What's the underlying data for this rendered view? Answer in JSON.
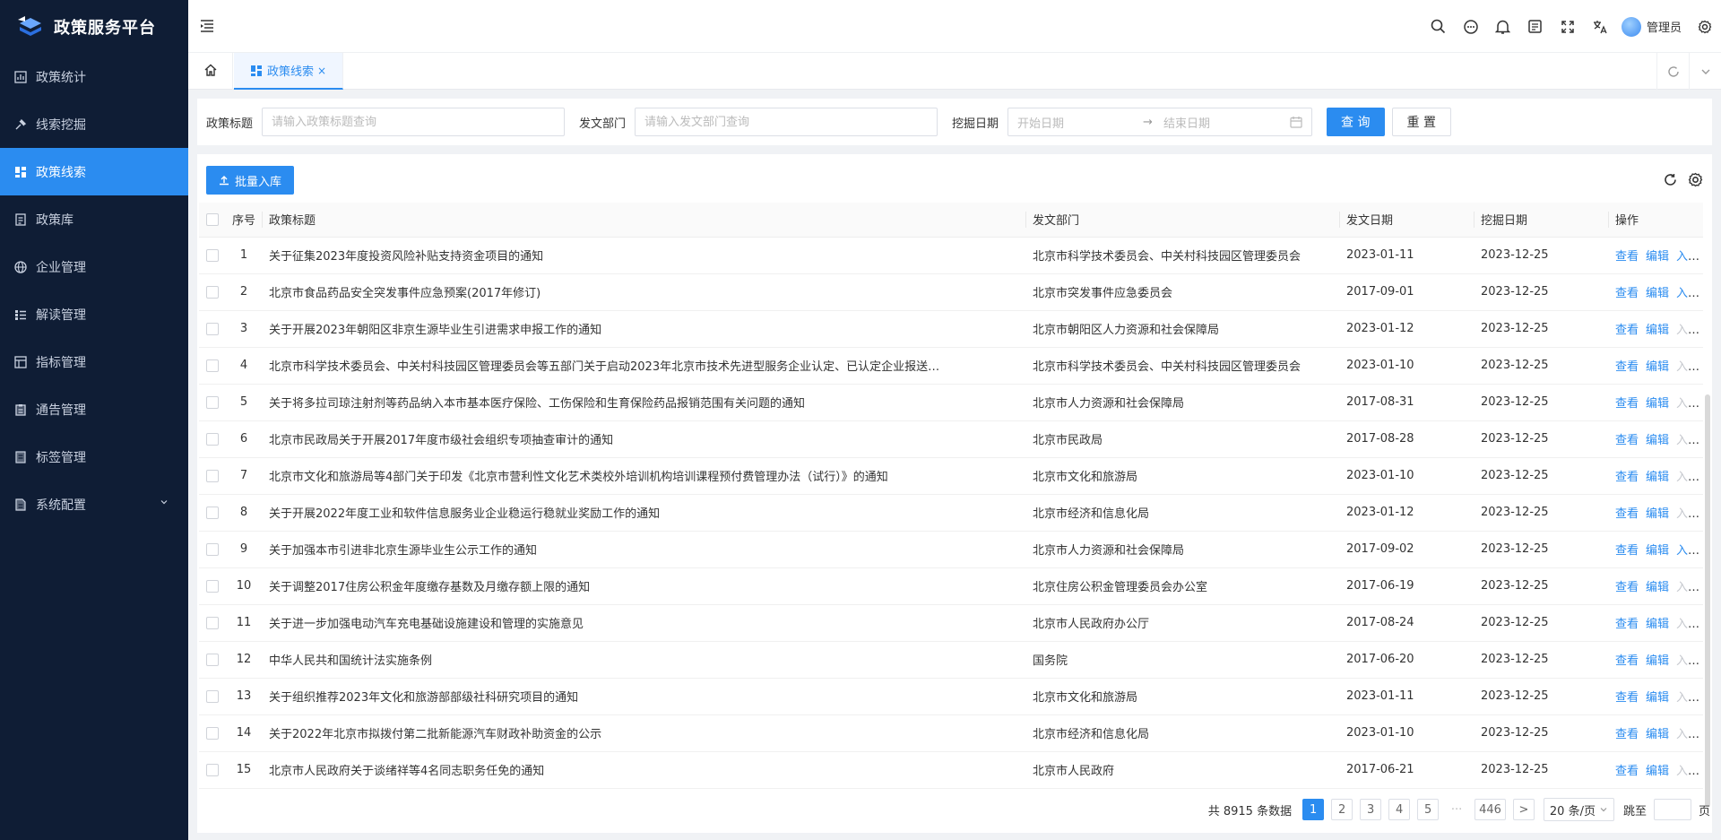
{
  "app": {
    "title": "政策服务平台"
  },
  "sidebar": {
    "items": [
      {
        "label": "政策统计",
        "icon": "chart-icon"
      },
      {
        "label": "线索挖掘",
        "icon": "pick-icon"
      },
      {
        "label": "政策线索",
        "icon": "dashboard-icon",
        "active": true
      },
      {
        "label": "政策库",
        "icon": "doc-icon"
      },
      {
        "label": "企业管理",
        "icon": "globe-icon"
      },
      {
        "label": "解读管理",
        "icon": "list-icon"
      },
      {
        "label": "指标管理",
        "icon": "form-icon"
      },
      {
        "label": "通告管理",
        "icon": "clipboard-icon"
      },
      {
        "label": "标签管理",
        "icon": "tag-icon"
      },
      {
        "label": "系统配置",
        "icon": "settings-doc-icon",
        "has_children": true
      }
    ]
  },
  "header": {
    "user_name": "管理员"
  },
  "tabs": {
    "active_label": "政策线索",
    "close_glyph": "×"
  },
  "search": {
    "title_label": "政策标题",
    "title_placeholder": "请输入政策标题查询",
    "dept_label": "发文部门",
    "dept_placeholder": "请输入发文部门查询",
    "date_label": "挖掘日期",
    "start_placeholder": "开始日期",
    "end_placeholder": "结束日期",
    "arrow": "→",
    "query_button": "查 询",
    "reset_button": "重 置"
  },
  "toolbar": {
    "batch_button": "批量入库"
  },
  "table": {
    "headers": {
      "index": "序号",
      "title": "政策标题",
      "dept": "发文部门",
      "issue_date": "发文日期",
      "mine_date": "挖掘日期",
      "ops": "操作"
    },
    "ops": {
      "view": "查看",
      "edit": "编辑",
      "store": "入库"
    },
    "rows": [
      {
        "index": "1",
        "title": "关于征集2023年度投资风险补贴支持资金项目的通知",
        "dept": "北京市科学技术委员会、中关村科技园区管理委员会",
        "issue_date": "2023-01-11",
        "mine_date": "2023-12-25",
        "store_enabled": true
      },
      {
        "index": "2",
        "title": "北京市食品药品安全突发事件应急预案(2017年修订)",
        "dept": "北京市突发事件应急委员会",
        "issue_date": "2017-09-01",
        "mine_date": "2023-12-25",
        "store_enabled": true
      },
      {
        "index": "3",
        "title": "关于开展2023年朝阳区非京生源毕业生引进需求申报工作的通知",
        "dept": "北京市朝阳区人力资源和社会保障局",
        "issue_date": "2023-01-12",
        "mine_date": "2023-12-25",
        "store_enabled": false
      },
      {
        "index": "4",
        "title": "北京市科学技术委员会、中关村科技园区管理委员会等五部门关于启动2023年北京市技术先进型服务企业认定、已认定企业报送…",
        "dept": "北京市科学技术委员会、中关村科技园区管理委员会",
        "issue_date": "2023-01-10",
        "mine_date": "2023-12-25",
        "store_enabled": false
      },
      {
        "index": "5",
        "title": "关于将多拉司琼注射剂等药品纳入本市基本医疗保险、工伤保险和生育保险药品报销范围有关问题的通知",
        "dept": "北京市人力资源和社会保障局",
        "issue_date": "2017-08-31",
        "mine_date": "2023-12-25",
        "store_enabled": false
      },
      {
        "index": "6",
        "title": "北京市民政局关于开展2017年度市级社会组织专项抽查审计的通知",
        "dept": "北京市民政局",
        "issue_date": "2017-08-28",
        "mine_date": "2023-12-25",
        "store_enabled": false
      },
      {
        "index": "7",
        "title": "北京市文化和旅游局等4部门关于印发《北京市营利性文化艺术类校外培训机构培训课程预付费管理办法（试行）》的通知",
        "dept": "北京市文化和旅游局",
        "issue_date": "2023-01-10",
        "mine_date": "2023-12-25",
        "store_enabled": false
      },
      {
        "index": "8",
        "title": "关于开展2022年度工业和软件信息服务业企业稳运行稳就业奖励工作的通知",
        "dept": "北京市经济和信息化局",
        "issue_date": "2023-01-12",
        "mine_date": "2023-12-25",
        "store_enabled": false
      },
      {
        "index": "9",
        "title": "关于加强本市引进非北京生源毕业生公示工作的通知",
        "dept": "北京市人力资源和社会保障局",
        "issue_date": "2017-09-02",
        "mine_date": "2023-12-25",
        "store_enabled": true
      },
      {
        "index": "10",
        "title": "关于调整2017住房公积金年度缴存基数及月缴存额上限的通知",
        "dept": "北京住房公积金管理委员会办公室",
        "issue_date": "2017-06-19",
        "mine_date": "2023-12-25",
        "store_enabled": false
      },
      {
        "index": "11",
        "title": "关于进一步加强电动汽车充电基础设施建设和管理的实施意见",
        "dept": "北京市人民政府办公厅",
        "issue_date": "2017-08-24",
        "mine_date": "2023-12-25",
        "store_enabled": false
      },
      {
        "index": "12",
        "title": "中华人民共和国统计法实施条例",
        "dept": "国务院",
        "issue_date": "2017-06-20",
        "mine_date": "2023-12-25",
        "store_enabled": false
      },
      {
        "index": "13",
        "title": "关于组织推荐2023年文化和旅游部部级社科研究项目的通知",
        "dept": "北京市文化和旅游局",
        "issue_date": "2023-01-11",
        "mine_date": "2023-12-25",
        "store_enabled": false
      },
      {
        "index": "14",
        "title": "关于2022年北京市拟拨付第二批新能源汽车财政补助资金的公示",
        "dept": "北京市经济和信息化局",
        "issue_date": "2023-01-10",
        "mine_date": "2023-12-25",
        "store_enabled": false
      },
      {
        "index": "15",
        "title": "北京市人民政府关于谈绪祥等4名同志职务任免的通知",
        "dept": "北京市人民政府",
        "issue_date": "2017-06-21",
        "mine_date": "2023-12-25",
        "store_enabled": false
      }
    ]
  },
  "pagination": {
    "total_text": "共 8915 条数据",
    "pages": [
      "1",
      "2",
      "3",
      "4",
      "5"
    ],
    "dots": "···",
    "last_page": "446",
    "next": ">",
    "page_size": "20 条/页",
    "jump_label": "跳至",
    "page_unit": "页"
  },
  "colors": {
    "primary": "#2b8cf0",
    "sidebar_bg": "#0f1d35"
  }
}
